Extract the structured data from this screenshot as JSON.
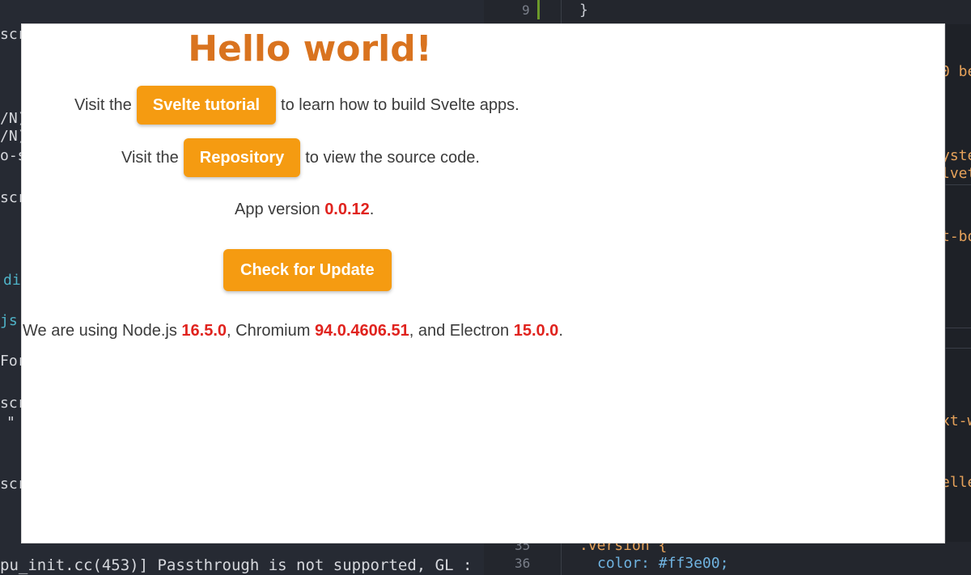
{
  "background": {
    "line_num_top": "9",
    "brace": "}",
    "left_fragments": [
      "scr",
      "/N)",
      "/N)",
      "o-s",
      "scr",
      "di",
      "js",
      "For",
      "scr",
      "\"",
      "scr"
    ],
    "right_fragments": [
      "0 be",
      "yste",
      "lvet",
      "t-bo",
      "xt-w",
      "elle"
    ],
    "terminal_line": "pu_init.cc(453)] Passthrough is not supported, GL :",
    "line_num_bottom_a": "35",
    "line_num_bottom_b": "36",
    "css_selector": ".version {",
    "css_prop": "color: #ff3e00;"
  },
  "app": {
    "title": "Hello world!",
    "tutorial_row": {
      "prefix": "Visit the",
      "button": "Svelte tutorial",
      "suffix": "to learn how to build Svelte apps."
    },
    "repo_row": {
      "prefix": "Visit the",
      "button": "Repository",
      "suffix": "to view the source code."
    },
    "version_row": {
      "prefix": "App version",
      "version": "0.0.12",
      "suffix": "."
    },
    "update_button": "Check for Update",
    "versions_row": {
      "t1": "We are using Node.js",
      "node": "16.5.0",
      "t2": ", Chromium",
      "chromium": "94.0.4606.51",
      "t3": ", and Electron",
      "electron": "15.0.0",
      "t4": "."
    },
    "colors": {
      "title": "#d9731f",
      "button": "#f59b11",
      "version": "#e0231e"
    }
  }
}
